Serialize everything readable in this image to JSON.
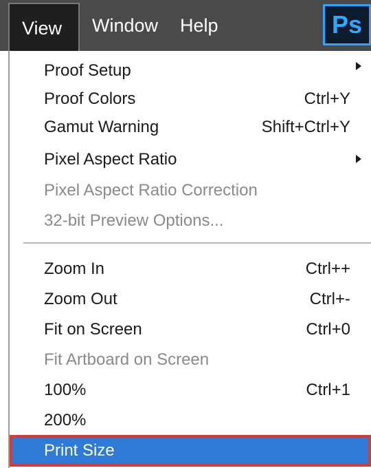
{
  "menubar": {
    "items": [
      {
        "label": "View",
        "active": true
      },
      {
        "label": "Window",
        "active": false
      },
      {
        "label": "Help",
        "active": false
      }
    ],
    "logo_text": "Ps",
    "logo_color": "#31a8ff"
  },
  "view_menu": {
    "items": [
      {
        "label": "Proof Setup",
        "shortcut": "",
        "submenu": true,
        "enabled": true
      },
      {
        "label": "Proof Colors",
        "shortcut": "Ctrl+Y",
        "submenu": false,
        "enabled": true
      },
      {
        "label": "Gamut Warning",
        "shortcut": "Shift+Ctrl+Y",
        "submenu": false,
        "enabled": true
      },
      {
        "label": "Pixel Aspect Ratio",
        "shortcut": "",
        "submenu": true,
        "enabled": true
      },
      {
        "label": "Pixel Aspect Ratio Correction",
        "shortcut": "",
        "submenu": false,
        "enabled": false
      },
      {
        "label": "32-bit Preview Options...",
        "shortcut": "",
        "submenu": false,
        "enabled": false
      },
      {
        "label": "Zoom In",
        "shortcut": "Ctrl++",
        "submenu": false,
        "enabled": true
      },
      {
        "label": "Zoom Out",
        "shortcut": "Ctrl+-",
        "submenu": false,
        "enabled": true
      },
      {
        "label": "Fit on Screen",
        "shortcut": "Ctrl+0",
        "submenu": false,
        "enabled": true
      },
      {
        "label": "Fit Artboard on Screen",
        "shortcut": "",
        "submenu": false,
        "enabled": false
      },
      {
        "label": "100%",
        "shortcut": "Ctrl+1",
        "submenu": false,
        "enabled": true
      },
      {
        "label": "200%",
        "shortcut": "",
        "submenu": false,
        "enabled": true
      },
      {
        "label": "Print Size",
        "shortcut": "",
        "submenu": false,
        "enabled": true,
        "highlighted": true
      }
    ],
    "highlight_color": "#2f7ad6",
    "highlight_border_color": "#d43a36"
  }
}
